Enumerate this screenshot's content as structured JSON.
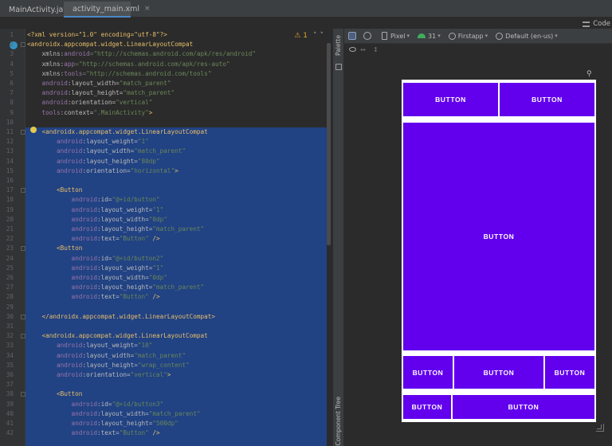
{
  "tabs": [
    {
      "label": "MainActivity.java",
      "close": "×",
      "icon": "java-class-icon"
    },
    {
      "label": "activity_main.xml",
      "close": "×",
      "icon": "xml-file-icon"
    }
  ],
  "view_mode": {
    "code_label": "Code"
  },
  "inspection": {
    "warning_count": "1"
  },
  "side_panels": {
    "palette": "Palette",
    "component_tree": "Component Tree"
  },
  "design_toolbar": {
    "device": "Pixel",
    "api": "31",
    "theme": "Firstapp",
    "locale": "Default (en-us)"
  },
  "editor": {
    "lines": [
      {
        "n": "1",
        "segments": [
          {
            "t": "<?xml version=\"1.0\" encoding=\"utf-8\"?>",
            "c": "decl"
          }
        ]
      },
      {
        "n": "2",
        "segments": [
          {
            "t": "<androidx.appcompat.widget.LinearLayoutCompat",
            "c": "tag"
          }
        ]
      },
      {
        "n": "3",
        "segments": [
          {
            "t": "    xmlns:",
            "c": "attr"
          },
          {
            "t": "android",
            "c": "ns"
          },
          {
            "t": "=\"http://schemas.android.com/apk/res/android\"",
            "c": "val"
          }
        ]
      },
      {
        "n": "4",
        "segments": [
          {
            "t": "    xmlns:",
            "c": "attr"
          },
          {
            "t": "app",
            "c": "ns"
          },
          {
            "t": "=\"http://schemas.android.com/apk/res-auto\"",
            "c": "val"
          }
        ]
      },
      {
        "n": "5",
        "segments": [
          {
            "t": "    xmlns:",
            "c": "attr"
          },
          {
            "t": "tools",
            "c": "ns"
          },
          {
            "t": "=\"http://schemas.android.com/tools\"",
            "c": "val"
          }
        ]
      },
      {
        "n": "6",
        "segments": [
          {
            "t": "    ",
            "c": "attr"
          },
          {
            "t": "android",
            "c": "ns"
          },
          {
            "t": ":layout_width=",
            "c": "attr"
          },
          {
            "t": "\"match_parent\"",
            "c": "val"
          }
        ]
      },
      {
        "n": "7",
        "segments": [
          {
            "t": "    ",
            "c": "attr"
          },
          {
            "t": "android",
            "c": "ns"
          },
          {
            "t": ":layout_height=",
            "c": "attr"
          },
          {
            "t": "\"match_parent\"",
            "c": "val"
          }
        ]
      },
      {
        "n": "8",
        "segments": [
          {
            "t": "    ",
            "c": "attr"
          },
          {
            "t": "android",
            "c": "ns"
          },
          {
            "t": ":orientation=",
            "c": "attr"
          },
          {
            "t": "\"vertical\"",
            "c": "val"
          }
        ]
      },
      {
        "n": "9",
        "segments": [
          {
            "t": "    ",
            "c": "attr"
          },
          {
            "t": "tools",
            "c": "ns"
          },
          {
            "t": ":context=",
            "c": "attr"
          },
          {
            "t": "\".MainActivity\"",
            "c": "val"
          },
          {
            "t": ">",
            "c": "tag"
          }
        ]
      },
      {
        "n": "10",
        "segments": []
      },
      {
        "n": "11",
        "segments": [
          {
            "t": "    <androidx.appcompat.widget.LinearLayoutCompat",
            "c": "tag"
          }
        ]
      },
      {
        "n": "12",
        "segments": [
          {
            "t": "        ",
            "c": "attr"
          },
          {
            "t": "android",
            "c": "ns"
          },
          {
            "t": ":layout_weight=",
            "c": "attr"
          },
          {
            "t": "\"1\"",
            "c": "val"
          }
        ]
      },
      {
        "n": "13",
        "segments": [
          {
            "t": "        ",
            "c": "attr"
          },
          {
            "t": "android",
            "c": "ns"
          },
          {
            "t": ":layout_width=",
            "c": "attr"
          },
          {
            "t": "\"match_parent\"",
            "c": "val"
          }
        ]
      },
      {
        "n": "14",
        "segments": [
          {
            "t": "        ",
            "c": "attr"
          },
          {
            "t": "android",
            "c": "ns"
          },
          {
            "t": ":layout_height=",
            "c": "attr"
          },
          {
            "t": "\"80dp\"",
            "c": "val"
          }
        ]
      },
      {
        "n": "15",
        "segments": [
          {
            "t": "        ",
            "c": "attr"
          },
          {
            "t": "android",
            "c": "ns"
          },
          {
            "t": ":orientation=",
            "c": "attr"
          },
          {
            "t": "\"horizontal\"",
            "c": "val"
          },
          {
            "t": ">",
            "c": "tag"
          }
        ]
      },
      {
        "n": "16",
        "segments": []
      },
      {
        "n": "17",
        "segments": [
          {
            "t": "        <Button",
            "c": "tag"
          }
        ]
      },
      {
        "n": "18",
        "segments": [
          {
            "t": "            ",
            "c": "attr"
          },
          {
            "t": "android",
            "c": "ns"
          },
          {
            "t": ":id=",
            "c": "attr"
          },
          {
            "t": "\"@+id/button\"",
            "c": "val"
          }
        ]
      },
      {
        "n": "19",
        "segments": [
          {
            "t": "            ",
            "c": "attr"
          },
          {
            "t": "android",
            "c": "ns"
          },
          {
            "t": ":layout_weight=",
            "c": "attr"
          },
          {
            "t": "\"1\"",
            "c": "val"
          }
        ]
      },
      {
        "n": "20",
        "segments": [
          {
            "t": "            ",
            "c": "attr"
          },
          {
            "t": "android",
            "c": "ns"
          },
          {
            "t": ":layout_width=",
            "c": "attr"
          },
          {
            "t": "\"0dp\"",
            "c": "val"
          }
        ]
      },
      {
        "n": "21",
        "segments": [
          {
            "t": "            ",
            "c": "attr"
          },
          {
            "t": "android",
            "c": "ns"
          },
          {
            "t": ":layout_height=",
            "c": "attr"
          },
          {
            "t": "\"match_parent\"",
            "c": "val"
          }
        ]
      },
      {
        "n": "22",
        "segments": [
          {
            "t": "            ",
            "c": "attr"
          },
          {
            "t": "android",
            "c": "ns"
          },
          {
            "t": ":text=",
            "c": "attr"
          },
          {
            "t": "\"Button\"",
            "c": "val"
          },
          {
            "t": " />",
            "c": "tag"
          }
        ]
      },
      {
        "n": "23",
        "segments": [
          {
            "t": "        <Button",
            "c": "tag"
          }
        ]
      },
      {
        "n": "24",
        "segments": [
          {
            "t": "            ",
            "c": "attr"
          },
          {
            "t": "android",
            "c": "ns"
          },
          {
            "t": ":id=",
            "c": "attr"
          },
          {
            "t": "\"@+id/button2\"",
            "c": "val"
          }
        ]
      },
      {
        "n": "25",
        "segments": [
          {
            "t": "            ",
            "c": "attr"
          },
          {
            "t": "android",
            "c": "ns"
          },
          {
            "t": ":layout_weight=",
            "c": "attr"
          },
          {
            "t": "\"1\"",
            "c": "val"
          }
        ]
      },
      {
        "n": "26",
        "segments": [
          {
            "t": "            ",
            "c": "attr"
          },
          {
            "t": "android",
            "c": "ns"
          },
          {
            "t": ":layout_width=",
            "c": "attr"
          },
          {
            "t": "\"0dp\"",
            "c": "val"
          }
        ]
      },
      {
        "n": "27",
        "segments": [
          {
            "t": "            ",
            "c": "attr"
          },
          {
            "t": "android",
            "c": "ns"
          },
          {
            "t": ":layout_height=",
            "c": "attr"
          },
          {
            "t": "\"match_parent\"",
            "c": "val"
          }
        ]
      },
      {
        "n": "28",
        "segments": [
          {
            "t": "            ",
            "c": "attr"
          },
          {
            "t": "android",
            "c": "ns"
          },
          {
            "t": ":text=",
            "c": "attr"
          },
          {
            "t": "\"Button\"",
            "c": "val"
          },
          {
            "t": " />",
            "c": "tag"
          }
        ]
      },
      {
        "n": "29",
        "segments": []
      },
      {
        "n": "30",
        "segments": [
          {
            "t": "    </androidx.appcompat.widget.LinearLayoutCompat>",
            "c": "tag"
          }
        ]
      },
      {
        "n": "31",
        "segments": []
      },
      {
        "n": "32",
        "segments": [
          {
            "t": "    <androidx.appcompat.widget.LinearLayoutCompat",
            "c": "tag"
          }
        ]
      },
      {
        "n": "33",
        "segments": [
          {
            "t": "        ",
            "c": "attr"
          },
          {
            "t": "android",
            "c": "ns"
          },
          {
            "t": ":layout_weight=",
            "c": "attr"
          },
          {
            "t": "\"10\"",
            "c": "val"
          }
        ]
      },
      {
        "n": "34",
        "segments": [
          {
            "t": "        ",
            "c": "attr"
          },
          {
            "t": "android",
            "c": "ns"
          },
          {
            "t": ":layout_width=",
            "c": "attr"
          },
          {
            "t": "\"match_parent\"",
            "c": "val"
          }
        ]
      },
      {
        "n": "35",
        "segments": [
          {
            "t": "        ",
            "c": "attr"
          },
          {
            "t": "android",
            "c": "ns"
          },
          {
            "t": ":layout_height=",
            "c": "attr"
          },
          {
            "t": "\"wrap_content\"",
            "c": "val"
          }
        ]
      },
      {
        "n": "36",
        "segments": [
          {
            "t": "        ",
            "c": "attr"
          },
          {
            "t": "android",
            "c": "ns"
          },
          {
            "t": ":orientation=",
            "c": "attr"
          },
          {
            "t": "\"vertical\"",
            "c": "val"
          },
          {
            "t": ">",
            "c": "tag"
          }
        ]
      },
      {
        "n": "37",
        "segments": []
      },
      {
        "n": "38",
        "segments": [
          {
            "t": "        <Button",
            "c": "tag"
          }
        ]
      },
      {
        "n": "39",
        "segments": [
          {
            "t": "            ",
            "c": "attr"
          },
          {
            "t": "android",
            "c": "ns"
          },
          {
            "t": ":id=",
            "c": "attr"
          },
          {
            "t": "\"@+id/button3\"",
            "c": "val"
          }
        ]
      },
      {
        "n": "40",
        "segments": [
          {
            "t": "            ",
            "c": "attr"
          },
          {
            "t": "android",
            "c": "ns"
          },
          {
            "t": ":layout_width=",
            "c": "attr"
          },
          {
            "t": "\"match_parent\"",
            "c": "val"
          }
        ]
      },
      {
        "n": "41",
        "segments": [
          {
            "t": "            ",
            "c": "attr"
          },
          {
            "t": "android",
            "c": "ns"
          },
          {
            "t": ":layout_height=",
            "c": "attr"
          },
          {
            "t": "\"500dp\"",
            "c": "val"
          }
        ]
      },
      {
        "n": "42",
        "segments": [
          {
            "t": "            ",
            "c": "attr"
          },
          {
            "t": "android",
            "c": "ns"
          },
          {
            "t": ":text=",
            "c": "attr"
          },
          {
            "t": "\"Button\"",
            "c": "val"
          },
          {
            "t": " />",
            "c": "tag"
          }
        ]
      }
    ]
  },
  "preview": {
    "accent": "#6200ee",
    "buttons": [
      "BUTTON",
      "BUTTON",
      "BUTTON",
      "BUTTON",
      "BUTTON",
      "BUTTON",
      "BUTTON",
      "BUTTON"
    ]
  }
}
